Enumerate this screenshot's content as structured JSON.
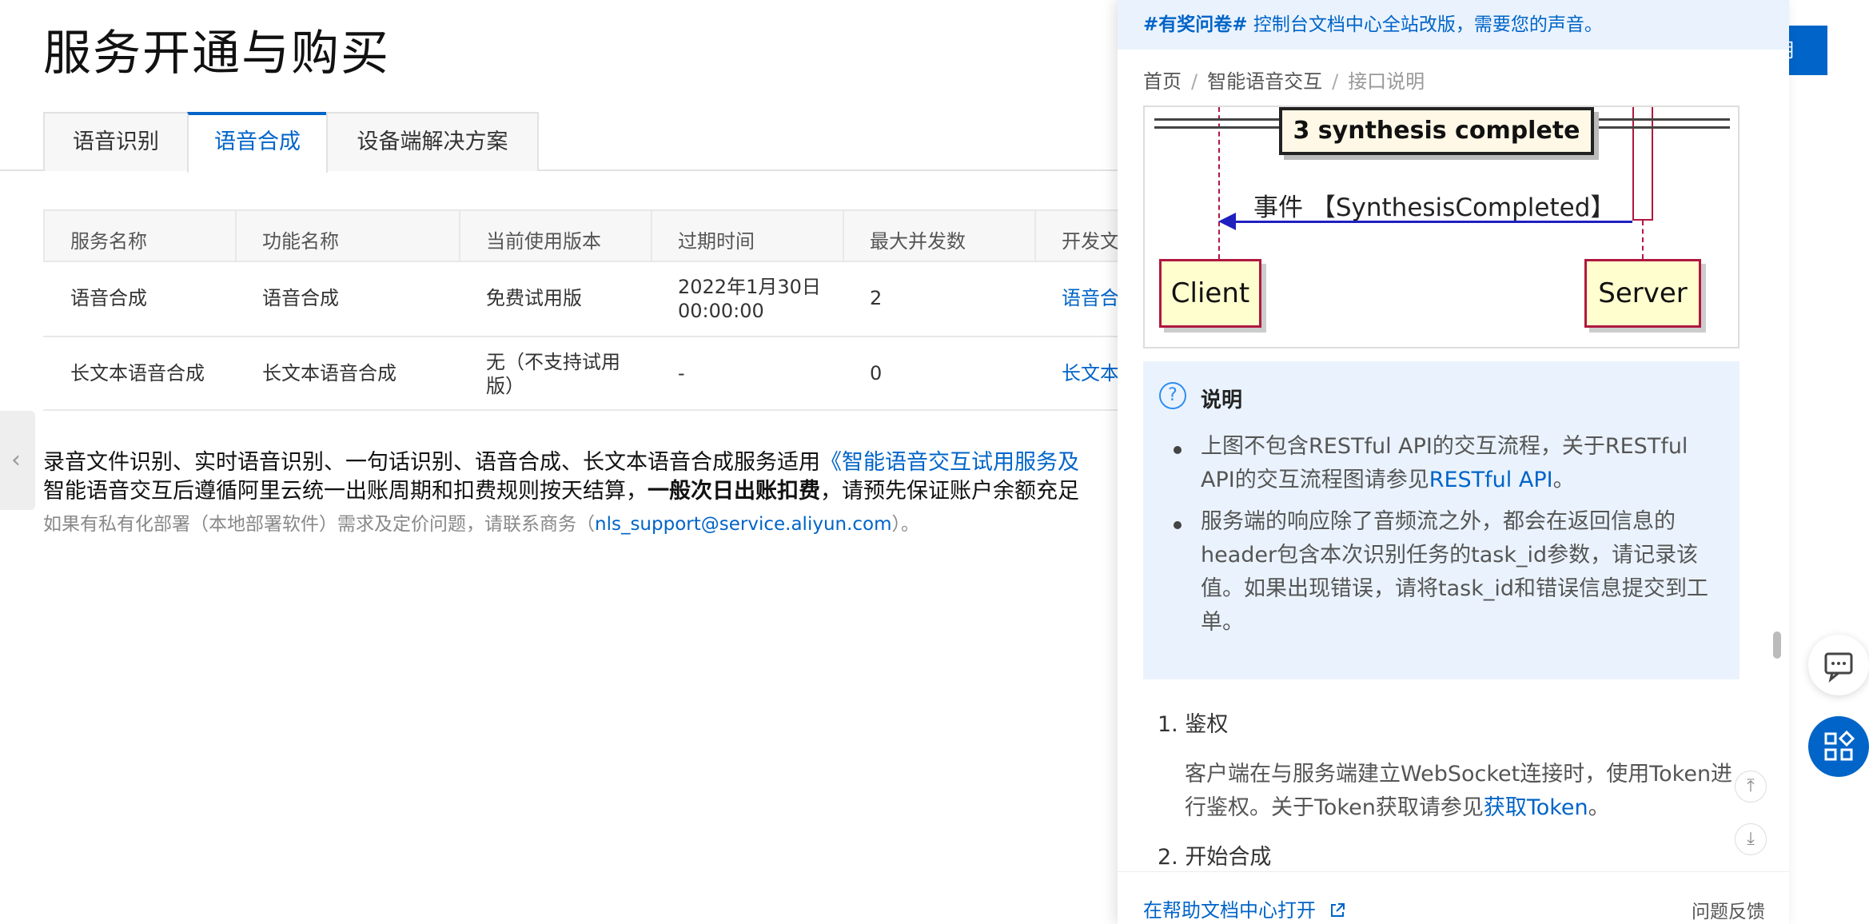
{
  "page": {
    "title": "服务开通与购买",
    "top_button_label": "明"
  },
  "tabs": [
    {
      "label": "语音识别",
      "active": false
    },
    {
      "label": "语音合成",
      "active": true
    },
    {
      "label": "设备端解决方案",
      "active": false
    }
  ],
  "table": {
    "headers": [
      "服务名称",
      "功能名称",
      "当前使用版本",
      "过期时间",
      "最大并发数",
      "开发文"
    ],
    "rows": [
      {
        "service": "语音合成",
        "feature": "语音合成",
        "version": "免费试用版",
        "expire": "2022年1月30日 00:00:00",
        "concurrency": "2",
        "doc": "语音合"
      },
      {
        "service": "长文本语音合成",
        "feature": "长文本语音合成",
        "version": "无（不支持试用版）",
        "expire": "-",
        "concurrency": "0",
        "doc": "长文本"
      }
    ]
  },
  "notices": {
    "line1_text": "录音文件识别、实时语音识别、一句话识别、语音合成、长文本语音合成服务适用",
    "line1_link": "《智能语音交互试用服务及",
    "line2_text": "智能语音交互后遵循阿里云统一出账周期和扣费规则按天结算，",
    "line2_bold": "一般次日出账扣费",
    "line2_tail": "，请预先保证账户余额充足",
    "line3_text": "如果有私有化部署（本地部署软件）需求及定价问题，请联系商务（",
    "line3_email": "nls_support@service.aliyun.com",
    "line3_tail": "）。"
  },
  "drawer": {
    "banner_tag": "#有奖问卷#",
    "banner_text": " 控制台文档中心全站改版，需要您的声音。",
    "breadcrumbs": [
      "首页",
      "智能语音交互",
      "接口说明"
    ],
    "diagram": {
      "complete_label": "3 synthesis complete",
      "message": "事件 【SynthesisCompleted】",
      "client": "Client",
      "server": "Server"
    },
    "note": {
      "title": "说明",
      "bullet1_text": "上图不包含RESTful API的交互流程，关于RESTful API的交互流程图请参见",
      "bullet1_link": "RESTful API",
      "bullet1_tail": "。",
      "bullet2": "服务端的响应除了音频流之外，都会在返回信息的header包含本次识别任务的task_id参数，请记录该值。如果出现错误，请将task_id和错误信息提交到工单。"
    },
    "steps": {
      "step1_title": "1. 鉴权",
      "step1_text": "客户端在与服务端建立WebSocket连接时，使用Token进行鉴权。关于Token获取请参见",
      "step1_link": "获取Token",
      "step1_tail": "。",
      "step2_title": "2. 开始合成"
    },
    "footer": {
      "open_label": "在帮助文档中心打开",
      "feedback_label": "问题反馈"
    }
  },
  "colors": {
    "primary": "#0064c8",
    "note_bg": "#eaf3fd",
    "actor_border": "#b01840",
    "actor_fill": "#fefece",
    "arrow": "#2020c0"
  }
}
